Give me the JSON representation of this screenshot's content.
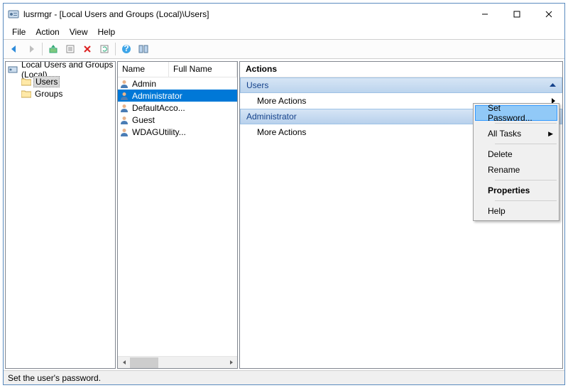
{
  "title": "lusrmgr - [Local Users and Groups (Local)\\Users]",
  "menu": {
    "file": "File",
    "action": "Action",
    "view": "View",
    "help": "Help"
  },
  "tree": {
    "root": "Local Users and Groups (Local)",
    "users": "Users",
    "groups": "Groups"
  },
  "list": {
    "cols": {
      "name": "Name",
      "full": "Full Name"
    },
    "rows": [
      "Admin",
      "Administrator",
      "DefaultAcco...",
      "Guest",
      "WDAGUtility..."
    ],
    "selectedIndex": 1
  },
  "actions": {
    "header": "Actions",
    "section_users": "Users",
    "section_admin": "Administrator",
    "more": "More Actions"
  },
  "context": {
    "set_password": "Set Password...",
    "all_tasks": "All Tasks",
    "delete": "Delete",
    "rename": "Rename",
    "properties": "Properties",
    "help": "Help"
  },
  "status": "Set the user's password."
}
